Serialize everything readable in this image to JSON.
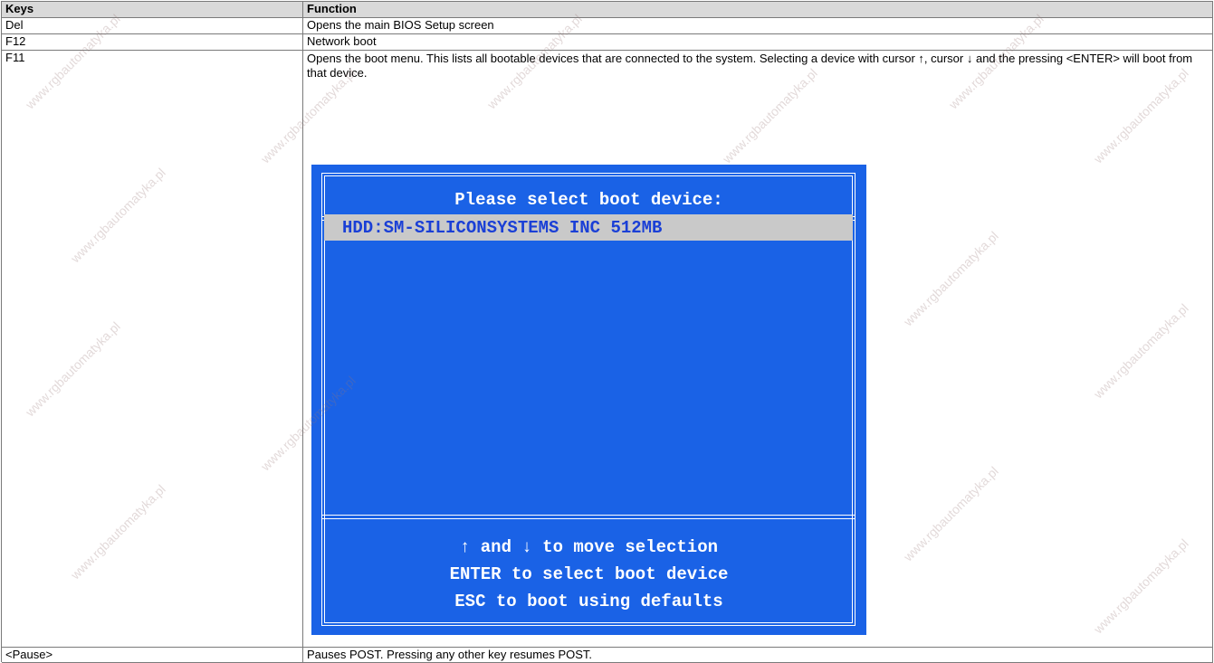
{
  "table": {
    "headers": [
      "Keys",
      "Function"
    ],
    "rows": [
      {
        "key": "Del",
        "function": "Opens the main BIOS Setup screen"
      },
      {
        "key": "F12",
        "function": "Network boot"
      },
      {
        "key": "F11",
        "function": "Opens the boot menu. This lists all bootable devices that are connected to the system. Selecting a device with cursor ↑, cursor ↓ and the pressing <ENTER> will boot from that device."
      },
      {
        "key": "<Pause>",
        "function": "Pauses POST. Pressing any other key resumes POST."
      }
    ]
  },
  "bios_menu": {
    "title": "Please select boot device:",
    "selected_device": "HDD:SM-SILICONSYSTEMS INC 512MB",
    "help": [
      "↑ and ↓ to move selection",
      "ENTER to select boot device",
      "ESC to boot using defaults"
    ],
    "colors": {
      "background": "#1a62e6",
      "selection_bar": "#c9c9c9",
      "selection_text": "#1a3fd6",
      "text": "#ffffff"
    }
  },
  "watermark_text": "www.rgbautomatyka.pl"
}
